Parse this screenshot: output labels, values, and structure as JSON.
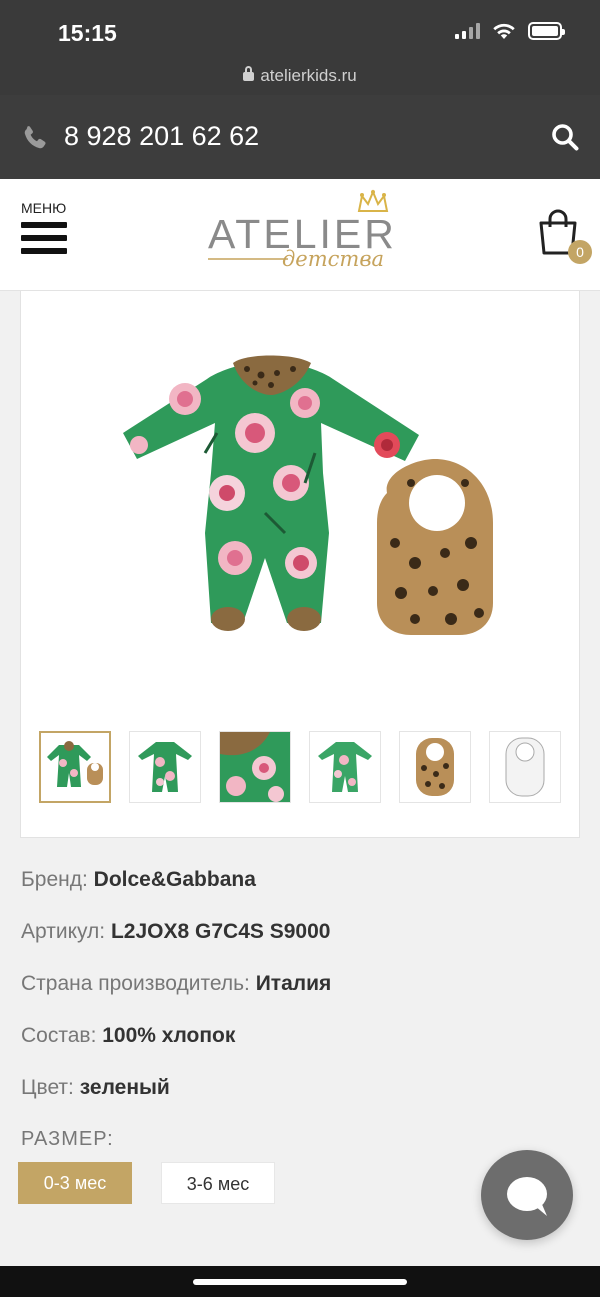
{
  "status_bar": {
    "time": "15:15",
    "url": "atelierkids.ru"
  },
  "header": {
    "phone": "8 928 201 62 62",
    "menu_label": "МЕНЮ",
    "logo_main": "ATELIER",
    "logo_sub": "детства",
    "cart_count": "0"
  },
  "product": {
    "thumbnails": [
      "romper-with-bib",
      "romper-front",
      "fabric-closeup",
      "romper-back",
      "bib-leopard",
      "bib-white"
    ],
    "active_thumbnail": 0,
    "details": [
      {
        "label": "Бренд:",
        "value": "Dolce&Gabbana"
      },
      {
        "label": "Артикул:",
        "value": "L2JOX8 G7C4S S9000"
      },
      {
        "label": "Страна производитель:",
        "value": "Италия"
      },
      {
        "label": "Состав:",
        "value": "100% хлопок"
      },
      {
        "label": "Цвет:",
        "value": "зеленый"
      }
    ],
    "size_label": "РАЗМЕР:",
    "sizes": [
      "0-3 мес",
      "3-6 мес"
    ],
    "selected_size": "0-3 мес"
  },
  "colors": {
    "accent": "#c3a565",
    "header_dark": "#3d3d3d",
    "fabric_green": "#2f9a5a"
  },
  "icons": [
    "phone-icon",
    "search-icon",
    "menu-icon",
    "cart-icon",
    "chat-icon",
    "lock-icon"
  ]
}
